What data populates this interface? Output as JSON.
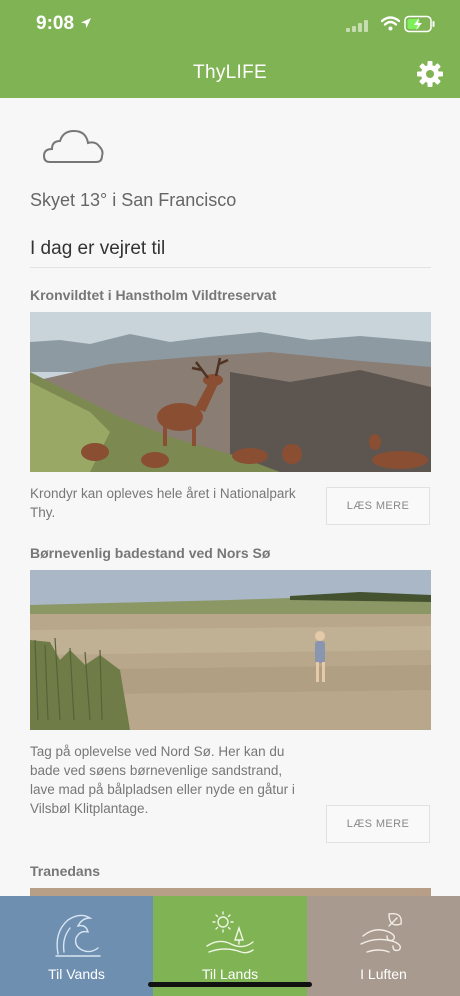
{
  "status_bar": {
    "time": "9:08"
  },
  "nav": {
    "title": "ThyLIFE"
  },
  "weather": {
    "summary": "Skyet 13° i San Francisco",
    "heading": "I dag er vejret til",
    "icon": "cloud-icon"
  },
  "cards": [
    {
      "title": "Kronvildtet i Hanstholm Vildtreservat",
      "description": "Krondyr kan opleves hele året i Nationalpark Thy.",
      "button": "LÆS MERE"
    },
    {
      "title": "Børnevenlig badestand ved Nors Sø",
      "description": "Tag på oplevelse ved Nord Sø. Her kan du bade ved søens børnevenlige sandstrand, lave mad på bålpladsen eller nyde en gåtur i Vilsbøl Klitplantage.",
      "button": "LÆS MERE"
    },
    {
      "title": "Tranedans"
    }
  ],
  "tabs": [
    {
      "label": "Til Vands",
      "icon": "wave-icon",
      "color": "#6e8fb0"
    },
    {
      "label": "Til Lands",
      "icon": "landscape-icon",
      "color": "#80b354"
    },
    {
      "label": "I Luften",
      "icon": "wind-leaf-icon",
      "color": "#a89a8f"
    }
  ],
  "colors": {
    "brand_green": "#80b354",
    "background": "#f7f7f7"
  }
}
